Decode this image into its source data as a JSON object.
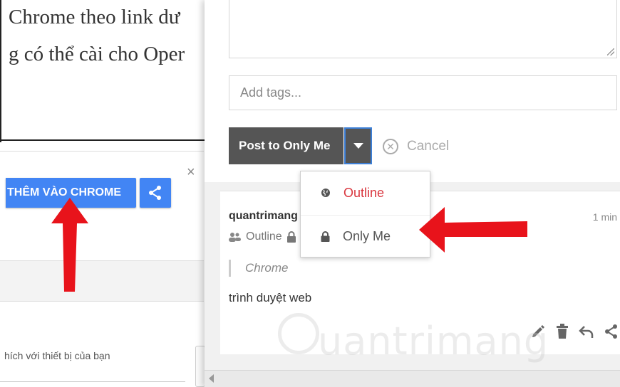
{
  "article": {
    "line1": "Chrome theo link dư",
    "line2": "g có thể cài cho Oper"
  },
  "extension": {
    "add_button_label": "THÊM VÀO CHROME",
    "close_symbol": "×",
    "description": "hích với thiết bị của bạn"
  },
  "composer": {
    "tags_placeholder": "Add tags...",
    "post_button_label": "Post to Only Me",
    "cancel_label": "Cancel"
  },
  "visibility_menu": {
    "items": [
      {
        "label": "Outline",
        "icon": "globe-icon"
      },
      {
        "label": "Only Me",
        "icon": "lock-icon"
      }
    ]
  },
  "post": {
    "author": "quantrimang",
    "time": "1 min",
    "audience": "Outline",
    "quote": "Chrome",
    "body": "trình duyệt web",
    "actions": [
      "edit-icon",
      "trash-icon",
      "reply-icon",
      "share-icon"
    ]
  },
  "watermark": {
    "text": "uantrimang"
  },
  "colors": {
    "chrome_blue": "#4285f4",
    "post_button": "#555555",
    "menu_accent": "#d9363e",
    "annotation_red": "#e8131b"
  }
}
